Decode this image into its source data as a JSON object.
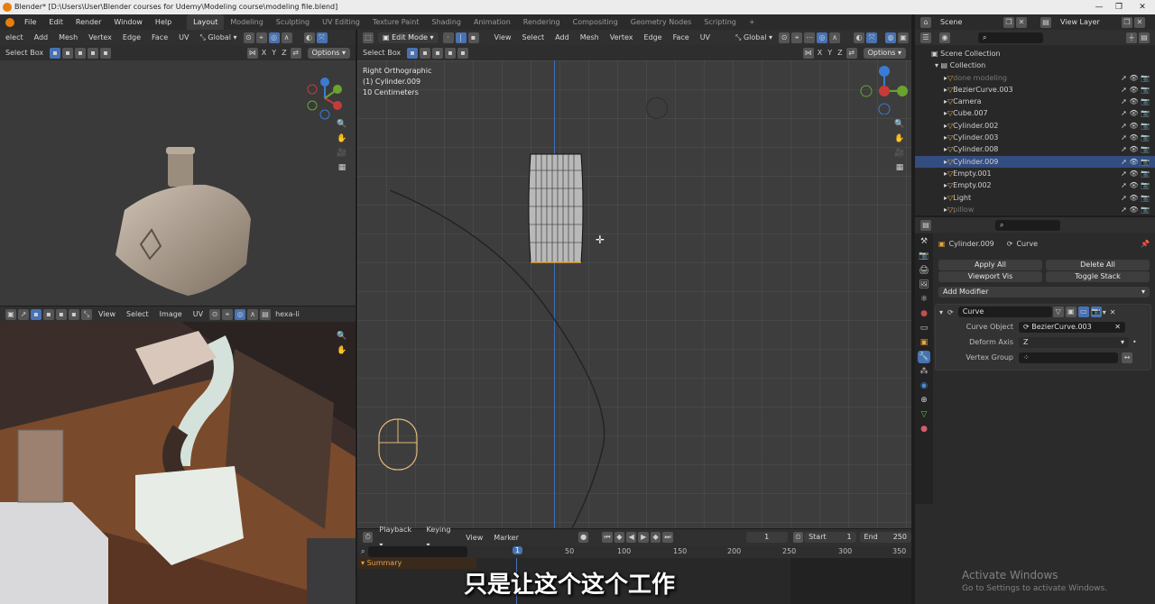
{
  "app": {
    "title": "Blender* [D:\\Users\\User\\Blender courses for Udemy\\Modeling course\\modeling file.blend]"
  },
  "menu": {
    "items": [
      "File",
      "Edit",
      "Render",
      "Window",
      "Help"
    ]
  },
  "workspaces": [
    "Layout",
    "Modeling",
    "Sculpting",
    "UV Editing",
    "Texture Paint",
    "Shading",
    "Animation",
    "Rendering",
    "Compositing",
    "Geometry Nodes",
    "Scripting"
  ],
  "active_workspace": "Layout",
  "top_right": {
    "scene": "Scene",
    "view_layer": "View Layer"
  },
  "left_viewport": {
    "menus": [
      "elect",
      "Add",
      "Mesh",
      "Vertex",
      "Edge",
      "Face",
      "UV"
    ],
    "orientation": "Global",
    "tool": "Select Box",
    "options": "Options",
    "axes": [
      "X",
      "Y",
      "Z"
    ]
  },
  "image_editor": {
    "menus": [
      "View",
      "Select",
      "Image",
      "UV"
    ],
    "image_name": "hexa-li"
  },
  "main_viewport": {
    "mode": "Edit Mode",
    "menus": [
      "View",
      "Select",
      "Add",
      "Mesh",
      "Vertex",
      "Edge",
      "Face",
      "UV"
    ],
    "orientation": "Global",
    "tool": "Select Box",
    "options": "Options",
    "axes": [
      "X",
      "Y",
      "Z"
    ],
    "info": [
      "Right Orthographic",
      "(1) Cylinder.009",
      "10 Centimeters"
    ]
  },
  "outliner": {
    "scene_collection": "Scene Collection",
    "collection": "Collection",
    "items": [
      {
        "name": "done modeling",
        "dim": true
      },
      {
        "name": "BezierCurve.003",
        "dim": false
      },
      {
        "name": "Camera",
        "dim": false
      },
      {
        "name": "Cube.007",
        "dim": false
      },
      {
        "name": "Cylinder.002",
        "dim": false
      },
      {
        "name": "Cylinder.003",
        "dim": false
      },
      {
        "name": "Cylinder.008",
        "dim": false
      },
      {
        "name": "Cylinder.009",
        "dim": false,
        "selected": true
      },
      {
        "name": "Empty.001",
        "dim": false
      },
      {
        "name": "Empty.002",
        "dim": false
      },
      {
        "name": "Light",
        "dim": false
      },
      {
        "name": "pillow",
        "dim": true
      }
    ]
  },
  "properties": {
    "object": "Cylinder.009",
    "modifier_tab_name": "Curve",
    "apply_all": "Apply All",
    "delete_all": "Delete All",
    "viewport_vis": "Viewport Vis",
    "toggle_stack": "Toggle Stack",
    "add_modifier": "Add Modifier",
    "modifier_name": "Curve",
    "curve_object_label": "Curve Object",
    "curve_object_value": "BezierCurve.003",
    "deform_axis_label": "Deform Axis",
    "deform_axis_value": "Z",
    "vertex_group_label": "Vertex Group"
  },
  "timeline": {
    "menus": [
      "Playback",
      "Keying",
      "View",
      "Marker"
    ],
    "current_frame": "1",
    "start_label": "Start",
    "start": "1",
    "end_label": "End",
    "end": "250",
    "ruler": [
      "1",
      "50",
      "100",
      "150",
      "200",
      "250",
      "300",
      "350"
    ],
    "summary": "Summary"
  },
  "subtitle": "只是让这个这个工作",
  "watermark": {
    "title": "Activate Windows",
    "sub": "Go to Settings to activate Windows."
  },
  "colors": {
    "accent": "#4772b3",
    "selected_row": "#334d80",
    "frame_marker": "#4772b3",
    "curve_icon": "#e7a53b"
  }
}
